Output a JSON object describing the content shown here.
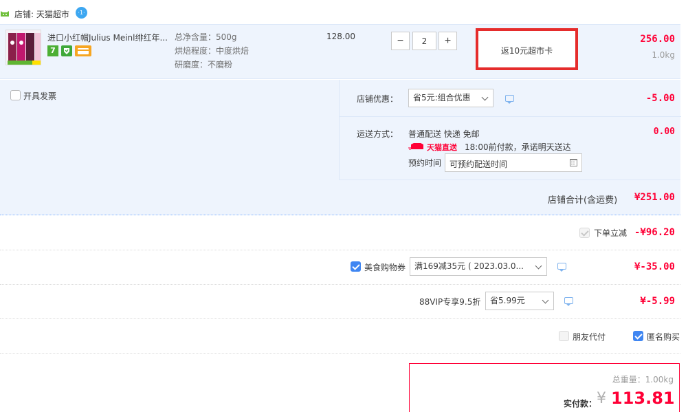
{
  "shop": {
    "label": "店铺: 天猫超市",
    "chat_badge": "·1·"
  },
  "item": {
    "title": "进口小红帽Julius Meinl绯红年...",
    "badge_seven": "7",
    "specs": [
      "总净含量：500g",
      "烘焙程度：中度烘焙",
      "研磨度：不磨粉"
    ],
    "unit_price": "128.00",
    "quantity": "2",
    "minus": "−",
    "plus": "+",
    "promo": "返10元超市卡",
    "subtotal": "256.00",
    "weight": "1.0kg"
  },
  "invoice": {
    "label": "开具发票"
  },
  "shop_discount": {
    "label": "店铺优惠：",
    "selected": "省5元:组合优惠",
    "amount": "-5.00"
  },
  "shipping": {
    "label": "运送方式：",
    "method": "普通配送 快递 免邮",
    "brand": "天猫直送",
    "promise": "18:00前付款，承诺明天送达",
    "reserve_label": "预约时间",
    "reserve_placeholder": "可预约配送时间",
    "amount": "0.00"
  },
  "shop_total": {
    "label": "店铺合计(含运费)",
    "amount": "¥251.00"
  },
  "instant_discount": {
    "label": "下单立减",
    "amount": "-¥96.20"
  },
  "coupon": {
    "label": "美食购物券",
    "selected": "满169减35元 ( 2023.03.0...",
    "amount": "¥-35.00"
  },
  "vip": {
    "label": "88VIP专享9.5折",
    "selected": "省5.99元",
    "amount": "¥-5.99"
  },
  "options": {
    "friend_pay": "朋友代付",
    "anonymous": "匿名购买"
  },
  "summary": {
    "weight_label": "总重量：1.00kg",
    "pay_label": "实付款：",
    "currency": "¥",
    "amount": "113.81"
  },
  "colors": {
    "accent_red": "#ff0036",
    "panel_bg": "#eef4fd",
    "checkbox_blue": "#3f86f2",
    "highlight_box": "#e52c2c"
  }
}
